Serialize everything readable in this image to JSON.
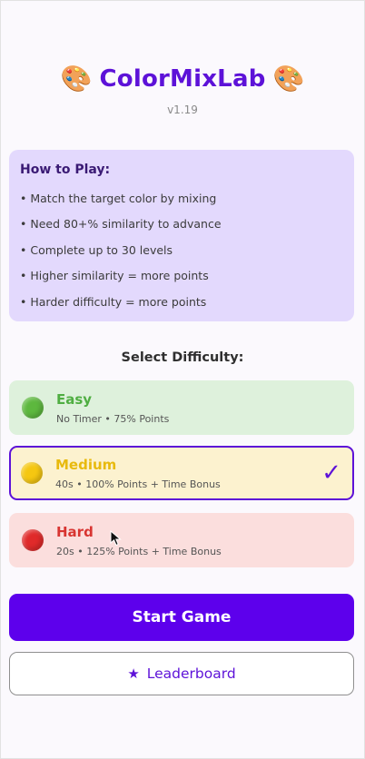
{
  "header": {
    "title": "ColorMixLab",
    "version": "v1.19",
    "left_icon": "palette-icon",
    "right_icon": "palette-icon"
  },
  "how_to_play": {
    "title": "How to Play:",
    "items": [
      "• Match the target color by mixing",
      "• Need 80+% similarity to advance",
      "• Complete up to 30 levels",
      "• Higher similarity = more points",
      "• Harder difficulty = more points"
    ]
  },
  "difficulty": {
    "label": "Select Difficulty:",
    "options": [
      {
        "name": "Easy",
        "desc": "No Timer • 75% Points",
        "color": "#5db83e",
        "selected": false
      },
      {
        "name": "Medium",
        "desc": "40s • 100% Points + Time Bonus",
        "color": "#f5c711",
        "selected": true
      },
      {
        "name": "Hard",
        "desc": "20s • 125% Points + Time Bonus",
        "color": "#e02a2a",
        "selected": false
      }
    ],
    "selected_mark": "✓"
  },
  "buttons": {
    "start_label": "Start Game",
    "leaderboard_label": "Leaderboard",
    "leaderboard_icon": "star-icon"
  },
  "colors": {
    "accent": "#5d12d8",
    "primary_button": "#5d00ec",
    "howto_bg": "#e3d9fd"
  }
}
